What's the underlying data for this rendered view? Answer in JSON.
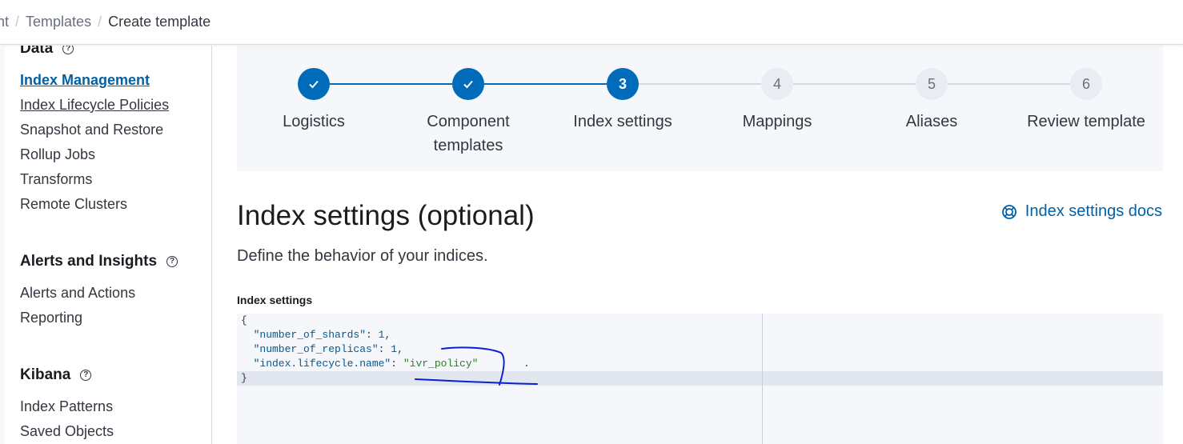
{
  "breadcrumb": {
    "items": [
      "nt",
      "Templates",
      "Create template"
    ],
    "separator": "/"
  },
  "sidebar": {
    "data_section": {
      "title": "Data"
    },
    "data_items": [
      "Index Management",
      "Index Lifecycle Policies",
      "Snapshot and Restore",
      "Rollup Jobs",
      "Transforms",
      "Remote Clusters"
    ],
    "alerts_section": {
      "title": "Alerts and Insights"
    },
    "alerts_items": [
      "Alerts and Actions",
      "Reporting"
    ],
    "kibana_section": {
      "title": "Kibana"
    },
    "kibana_items": [
      "Index Patterns",
      "Saved Objects"
    ]
  },
  "stepper": {
    "steps": [
      {
        "label": "Logistics",
        "status": "complete",
        "number": "1"
      },
      {
        "label": "Component templates",
        "status": "complete",
        "number": "2"
      },
      {
        "label": "Index settings",
        "status": "current",
        "number": "3"
      },
      {
        "label": "Mappings",
        "status": "incomplete",
        "number": "4"
      },
      {
        "label": "Aliases",
        "status": "incomplete",
        "number": "5"
      },
      {
        "label": "Review template",
        "status": "incomplete",
        "number": "6"
      }
    ]
  },
  "main": {
    "title": "Index settings (optional)",
    "docs_link": "Index settings docs",
    "description": "Define the behavior of your indices.",
    "field_label": "Index settings"
  },
  "editor": {
    "lines": [
      "{",
      "  \"number_of_shards\": 1,",
      "  \"number_of_replicas\": 1,",
      "  \"index.lifecycle.name\": \"ivr_policy\"",
      "}"
    ],
    "stray_char": "."
  },
  "colors": {
    "accent": "#006bb8",
    "link": "#0061a6",
    "annotation": "#0a1fd6"
  }
}
